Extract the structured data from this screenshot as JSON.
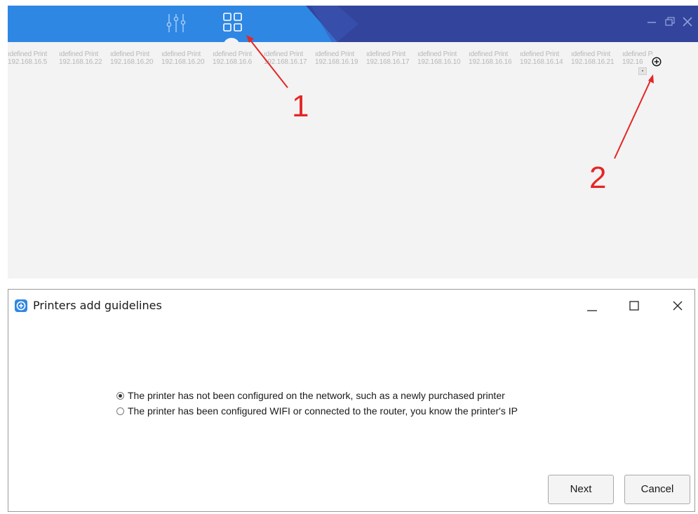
{
  "app": {
    "printers": [
      {
        "name": "ıdefined Print",
        "ip": "192.168.16.5"
      },
      {
        "name": "ıdefined Print",
        "ip": "192.168.16.22"
      },
      {
        "name": "ıdefined Print",
        "ip": "192.168.16.20"
      },
      {
        "name": "ıdefined Print",
        "ip": "192.168.16.20"
      },
      {
        "name": "ıdefined Print",
        "ip": "192.168.16.6"
      },
      {
        "name": "ıdefined Print",
        "ip": "192.168.16.17"
      },
      {
        "name": "ıdefined Print",
        "ip": "192.168.16.19"
      },
      {
        "name": "ıdefined Print",
        "ip": "192.168.16.17"
      },
      {
        "name": "ıdefined Print",
        "ip": "192.168.16.10"
      },
      {
        "name": "ıdefined Print",
        "ip": "192.168.16.16"
      },
      {
        "name": "ıdefined Print",
        "ip": "192.168.16.14"
      },
      {
        "name": "ıdefined Print",
        "ip": "192.168.16.21"
      },
      {
        "name": "ıdefined Printır",
        "ip": "192.16"
      }
    ],
    "small_button_label": "▪",
    "icons": {
      "settings": "sliders-icon",
      "apps": "grid-icon",
      "add": "plus-circle-icon",
      "minimize": "minimize-icon",
      "restore": "restore-icon",
      "close": "close-icon"
    },
    "colors": {
      "titlebar_blue": "#2f87e4",
      "titlebar_dark": "#33449c",
      "annotation_red": "#e52626"
    }
  },
  "annotations": {
    "label_1": "1",
    "label_2": "2"
  },
  "dialog": {
    "title": "Printers add guidelines",
    "options": [
      {
        "label": "The printer has not been configured on the network, such as a newly purchased printer",
        "selected": true
      },
      {
        "label": "The printer has been configured WIFI or connected to the router, you know the printer's IP",
        "selected": false
      }
    ],
    "next_label": "Next",
    "cancel_label": "Cancel",
    "icons": {
      "app": "printer-app-icon",
      "minimize": "minimize-icon",
      "maximize": "maximize-icon",
      "close": "close-icon"
    }
  }
}
